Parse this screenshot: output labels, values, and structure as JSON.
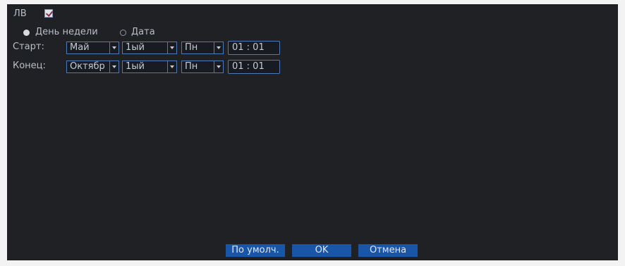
{
  "dst": {
    "label": "ЛВ",
    "enabled": true
  },
  "mode": {
    "options": [
      {
        "label": "День недели",
        "selected": true
      },
      {
        "label": "Дата",
        "selected": false
      }
    ]
  },
  "start": {
    "label": "Старт:",
    "month": "Май",
    "week": "1ый",
    "day": "Пн",
    "time": "01 : 01"
  },
  "end": {
    "label": "Конец:",
    "month": "Октябр",
    "week": "1ый",
    "day": "Пн",
    "time": "01 : 01"
  },
  "buttons": {
    "default": "По умолч.",
    "ok": "OK",
    "cancel": "Отмена"
  },
  "colors": {
    "panel_bg": "#1f2124",
    "accent": "#1a56a8",
    "field_border": "#4d79b6"
  },
  "icons": {
    "checkbox": "checkbox-checked-icon",
    "radio_on": "radio-selected-icon",
    "radio_off": "radio-unselected-icon",
    "dropdown": "dropdown-arrow-icon"
  }
}
